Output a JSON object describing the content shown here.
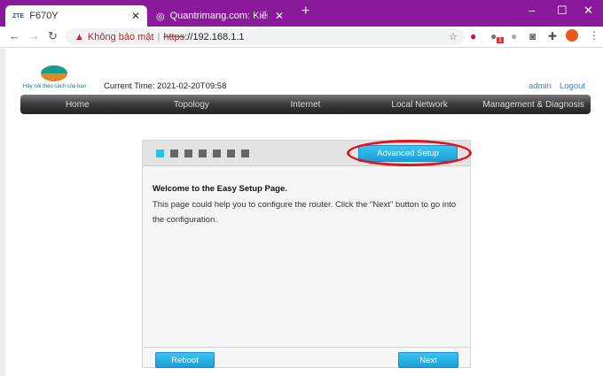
{
  "browser": {
    "tabs": [
      {
        "favicon": "ZTE",
        "title": "F670Y"
      },
      {
        "title": "Quantrimang.com: Kiến Thức Cô"
      }
    ],
    "security_label": "Không bảo mật",
    "url_scheme": "https",
    "url_rest": "://192.168.1.1",
    "extension_badge": "1"
  },
  "header": {
    "logo_text": "VIETTEL",
    "slogan": "Hãy nói theo cách của bạn",
    "current_time": "Current Time: 2021-02-20T09:58",
    "user": "admin",
    "logout": "Logout"
  },
  "nav": [
    "Home",
    "Topology",
    "Internet",
    "Local Network",
    "Management & Diagnosis"
  ],
  "setup": {
    "steps_total": 7,
    "current_step": 1,
    "advanced_button": "Advanced Setup",
    "title": "Welcome to the Easy Setup Page.",
    "body": "This page could help you to configure the router. Click the \"Next\" button to go into the configuration.",
    "reboot": "Reboot",
    "next": "Next"
  }
}
